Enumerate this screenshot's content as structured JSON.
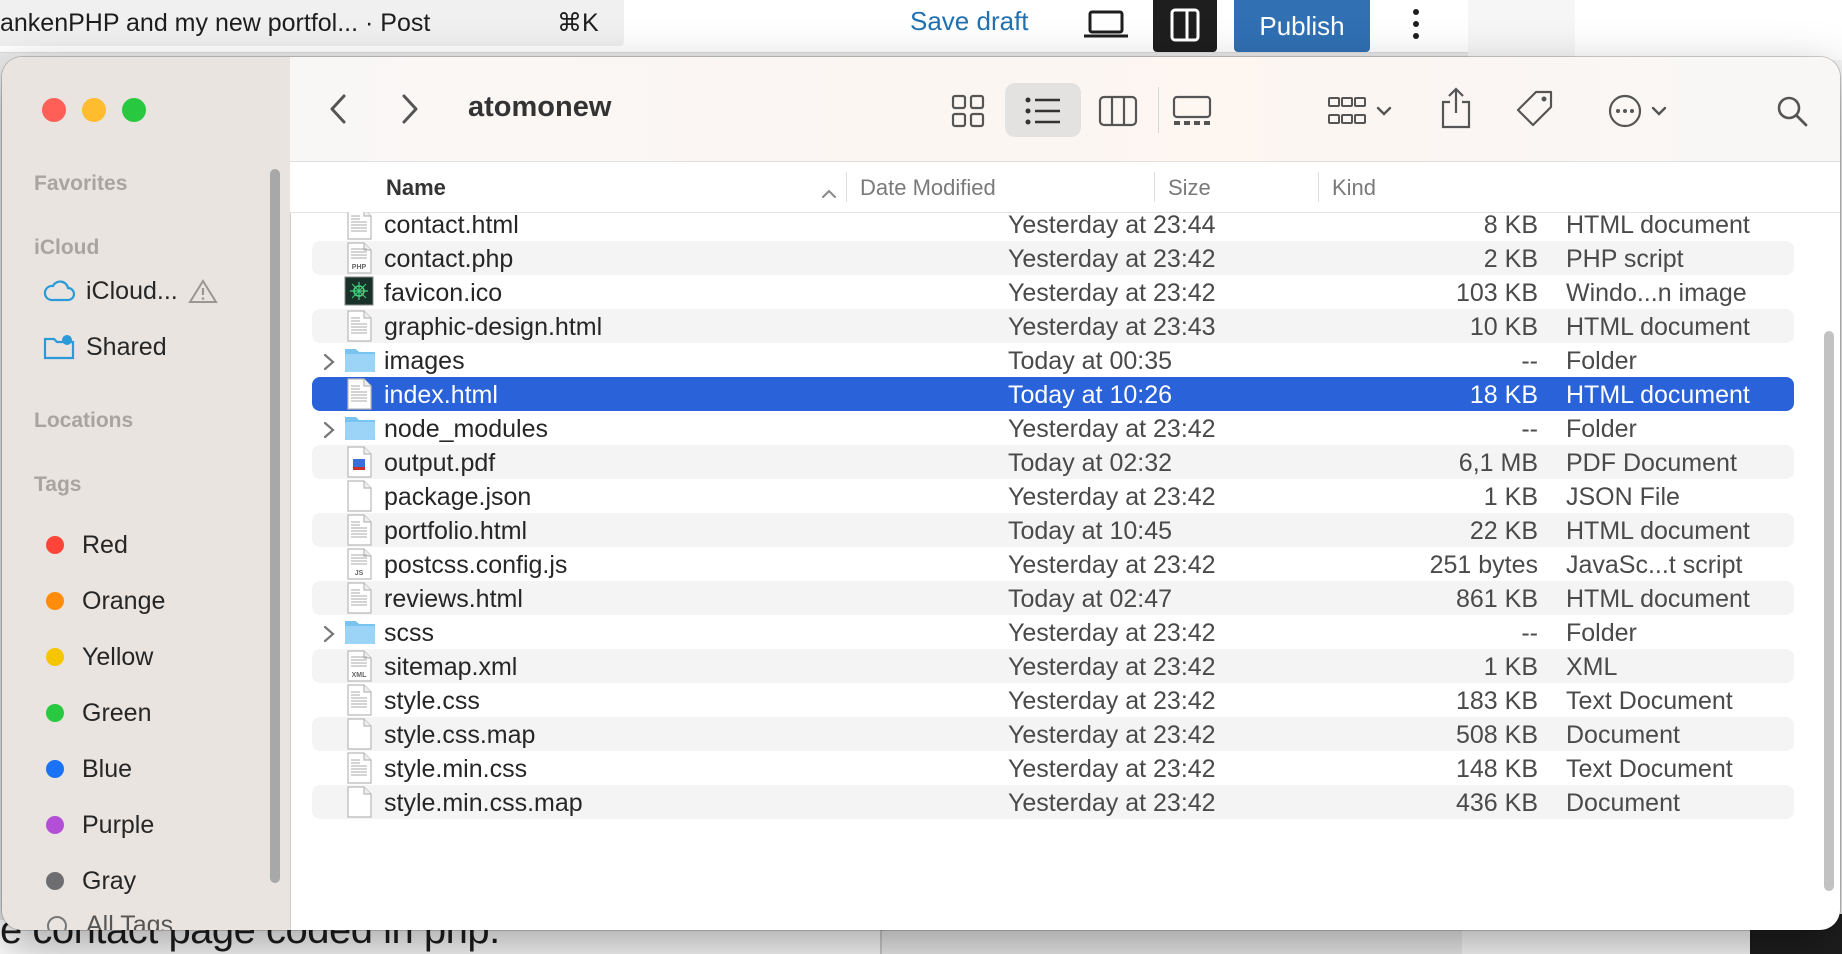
{
  "editor": {
    "post_title": "ankenPHP and my new portfol...  · Post",
    "shortcut": "⌘K",
    "save_draft": "Save draft",
    "publish": "Publish",
    "bottom_text": "e contact page coded in php."
  },
  "finder": {
    "folder_title": "atomonew",
    "sidebar": {
      "favorites_label": "Favorites",
      "icloud_label": "iCloud",
      "icloud_items": [
        {
          "label": "iCloud...",
          "icon": "cloud-icon"
        },
        {
          "label": "Shared",
          "icon": "shared-folder-icon"
        }
      ],
      "locations_label": "Locations",
      "tags_label": "Tags",
      "tags": [
        {
          "label": "Red",
          "color": "#ff453a"
        },
        {
          "label": "Orange",
          "color": "#ff8c0a"
        },
        {
          "label": "Yellow",
          "color": "#f5c500"
        },
        {
          "label": "Green",
          "color": "#28c840"
        },
        {
          "label": "Blue",
          "color": "#1a73f5"
        },
        {
          "label": "Purple",
          "color": "#b24fd6"
        },
        {
          "label": "Gray",
          "color": "#6e6e70"
        }
      ],
      "all_tags": "All Tags..."
    },
    "columns": {
      "name": "Name",
      "date": "Date Modified",
      "size": "Size",
      "kind": "Kind"
    },
    "files": [
      {
        "name": "contact.html",
        "date": "Yesterday at 23:44",
        "size": "8 KB",
        "kind": "HTML document",
        "type": "html"
      },
      {
        "name": "contact.php",
        "date": "Yesterday at 23:42",
        "size": "2 KB",
        "kind": "PHP script",
        "type": "php"
      },
      {
        "name": "favicon.ico",
        "date": "Yesterday at 23:42",
        "size": "103 KB",
        "kind": "Windo...n image",
        "type": "ico"
      },
      {
        "name": "graphic-design.html",
        "date": "Yesterday at 23:43",
        "size": "10 KB",
        "kind": "HTML document",
        "type": "html"
      },
      {
        "name": "images",
        "date": "Today at 00:35",
        "size": "--",
        "kind": "Folder",
        "type": "folder"
      },
      {
        "name": "index.html",
        "date": "Today at 10:26",
        "size": "18 KB",
        "kind": "HTML document",
        "type": "html",
        "selected": true
      },
      {
        "name": "node_modules",
        "date": "Yesterday at 23:42",
        "size": "--",
        "kind": "Folder",
        "type": "folder"
      },
      {
        "name": "output.pdf",
        "date": "Today at 02:32",
        "size": "6,1 MB",
        "kind": "PDF Document",
        "type": "pdf"
      },
      {
        "name": "package.json",
        "date": "Yesterday at 23:42",
        "size": "1 KB",
        "kind": "JSON File",
        "type": "blank"
      },
      {
        "name": "portfolio.html",
        "date": "Today at 10:45",
        "size": "22 KB",
        "kind": "HTML document",
        "type": "html"
      },
      {
        "name": "postcss.config.js",
        "date": "Yesterday at 23:42",
        "size": "251 bytes",
        "kind": "JavaSc...t script",
        "type": "js"
      },
      {
        "name": "reviews.html",
        "date": "Today at 02:47",
        "size": "861 KB",
        "kind": "HTML document",
        "type": "html"
      },
      {
        "name": "scss",
        "date": "Yesterday at 23:42",
        "size": "--",
        "kind": "Folder",
        "type": "folder"
      },
      {
        "name": "sitemap.xml",
        "date": "Yesterday at 23:42",
        "size": "1 KB",
        "kind": "XML",
        "type": "xml"
      },
      {
        "name": "style.css",
        "date": "Yesterday at 23:42",
        "size": "183 KB",
        "kind": "Text Document",
        "type": "text"
      },
      {
        "name": "style.css.map",
        "date": "Yesterday at 23:42",
        "size": "508 KB",
        "kind": "Document",
        "type": "blank"
      },
      {
        "name": "style.min.css",
        "date": "Yesterday at 23:42",
        "size": "148 KB",
        "kind": "Text Document",
        "type": "text"
      },
      {
        "name": "style.min.css.map",
        "date": "Yesterday at 23:42",
        "size": "436 KB",
        "kind": "Document",
        "type": "blank"
      }
    ],
    "colors": {
      "selection": "#2962d9",
      "sidebar_bg": "#eae4e0"
    }
  }
}
